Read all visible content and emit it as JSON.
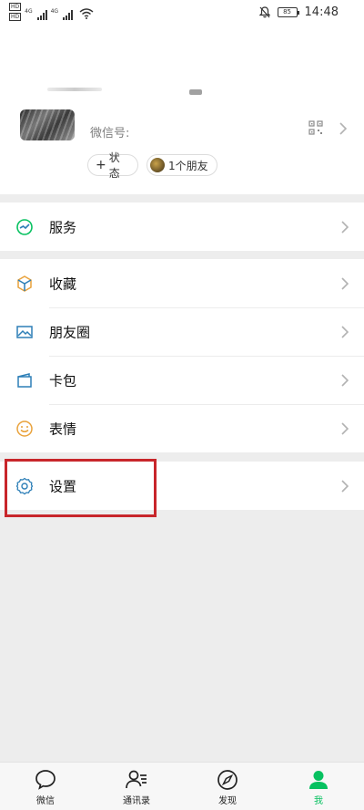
{
  "status_bar": {
    "sim1": "HD",
    "sim2": "HD",
    "net1": "4G",
    "net2": "4G",
    "battery": "85",
    "time": "14:48",
    "icons": [
      "wifi-icon",
      "mute-bell-icon"
    ]
  },
  "profile": {
    "wechat_id_label": "微信号:",
    "status_button": "状态",
    "friends_button": "1个朋友"
  },
  "menu": {
    "service": {
      "label": "服务",
      "icon": "service-icon"
    },
    "favorites": {
      "label": "收藏",
      "icon": "cube-icon"
    },
    "moments": {
      "label": "朋友圈",
      "icon": "image-icon"
    },
    "cards": {
      "label": "卡包",
      "icon": "wallet-icon"
    },
    "stickers": {
      "label": "表情",
      "icon": "smile-icon"
    },
    "settings": {
      "label": "设置",
      "icon": "gear-icon"
    }
  },
  "tabbar": [
    {
      "label": "微信",
      "icon": "chat-icon",
      "active": false
    },
    {
      "label": "通讯录",
      "icon": "contacts-icon",
      "active": false
    },
    {
      "label": "发现",
      "icon": "compass-icon",
      "active": false
    },
    {
      "label": "我",
      "icon": "person-icon",
      "active": true
    }
  ],
  "colors": {
    "accent": "#07c160",
    "highlight_box": "#c8262b",
    "icon_blue": "#2d7fb7"
  }
}
